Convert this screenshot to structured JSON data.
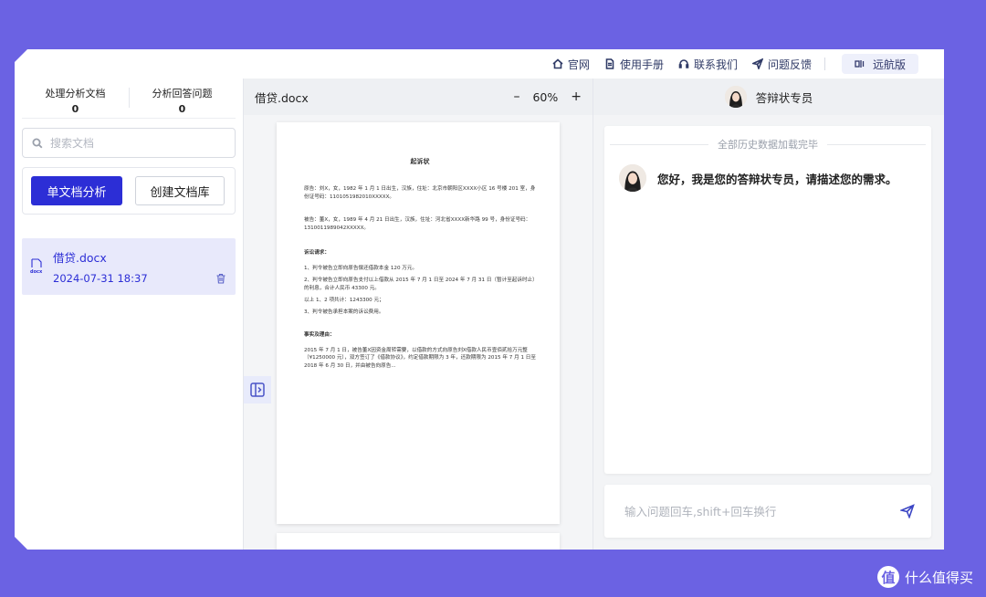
{
  "nav": {
    "links": [
      "官网",
      "使用手册",
      "联系我们",
      "问题反馈"
    ],
    "version": "远航版"
  },
  "sidebar": {
    "stats": [
      {
        "label": "处理分析文档",
        "value": "0"
      },
      {
        "label": "分析回答问题",
        "value": "0"
      }
    ],
    "search_placeholder": "搜索文档",
    "btn_single": "单文档分析",
    "btn_create": "创建文档库",
    "docs": [
      {
        "name": "借贷.docx",
        "date": "2024-07-31 18:37",
        "icon": "docx"
      }
    ]
  },
  "viewer": {
    "filename": "借贷.docx",
    "zoom": "60%",
    "minus": "–",
    "plus": "+",
    "doc": {
      "title": "起诉状",
      "plaintiff": "原告：刘X，女，1982 年 1 月 1 日出生，汉族，住址：北京市朝阳区XXXX小区 16 号楼 201 室，身份证号码：1101051982010XXXXX。",
      "defendant": "被告：董X，女，1989 年 4 月 21 日出生，汉族，住址：河北省XXXX新华路 99 号，身份证号码：1310011989042XXXXX。",
      "claims_h": "诉讼请求：",
      "claims": [
        "1、判令被告立即向原告偿还借款本金 120 万元。",
        "2、判令被告立即向原告支付以上借款从 2015 年 7 月 1 日至 2024 年 7 月 31 日（暂计至起诉时止）的利息，合计人民币 43300 元。",
        "以上 1、2 项共计：1243300 元；",
        "3、判令被告承担本案的诉讼费用。"
      ],
      "facts_h": "事实及理由：",
      "facts": "2015 年 7 月 1 日，被告董X因资金周转需要，以借款的方式向原告刘X借款人民币壹佰贰拾万元整（¥1250000 元），双方签订了《借款协议》，约定借款期限为 3 年，还款期限为 2015 年 7 月 1 日至 2018 年 6 月 30 日，并由被告向原告..."
    }
  },
  "chat": {
    "agent_name": "答辩状专员",
    "history_note": "全部历史数据加载完毕",
    "greeting": "您好，我是您的答辩状专员，请描述您的需求。",
    "input_placeholder": "输入问题回车,shift+回车换行"
  },
  "watermark": {
    "badge": "值",
    "text": "什么值得买"
  }
}
